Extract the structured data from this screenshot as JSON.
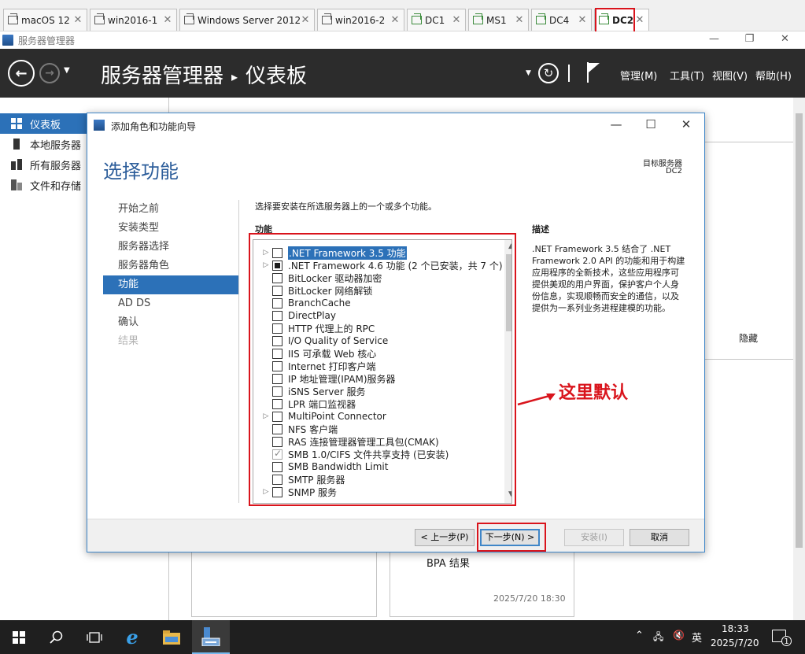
{
  "vm_tabs": [
    {
      "label": "macOS 12",
      "active": false
    },
    {
      "label": "win2016-1",
      "active": false
    },
    {
      "label": "Windows Server 2012",
      "active": false
    },
    {
      "label": "win2016-2",
      "active": false
    },
    {
      "label": "DC1",
      "active": false
    },
    {
      "label": "MS1",
      "active": false
    },
    {
      "label": "DC4",
      "active": false
    },
    {
      "label": "DC2",
      "active": true
    }
  ],
  "window": {
    "title": "服务器管理器",
    "minimize": "—",
    "restore": "❐",
    "close": "✕"
  },
  "header": {
    "breadcrumb_root": "服务器管理器",
    "breadcrumb_separator": "▸",
    "breadcrumb_current": "仪表板",
    "menus": [
      "管理(M)",
      "工具(T)",
      "视图(V)",
      "帮助(H)"
    ]
  },
  "sidebar": {
    "items": [
      {
        "label": "仪表板",
        "active": true
      },
      {
        "label": "本地服务器",
        "active": false
      },
      {
        "label": "所有服务器",
        "active": false
      },
      {
        "label": "文件和存储",
        "active": false
      }
    ]
  },
  "dashboard": {
    "hide_link": "隐藏",
    "tile_bpa_label": "BPA 结果",
    "tile_timestamp": "2025/7/20 18:30"
  },
  "wizard": {
    "title": "添加角色和功能向导",
    "heading": "选择功能",
    "target_label": "目标服务器",
    "target_value": "DC2",
    "steps": [
      {
        "label": "开始之前",
        "state": "normal"
      },
      {
        "label": "安装类型",
        "state": "normal"
      },
      {
        "label": "服务器选择",
        "state": "normal"
      },
      {
        "label": "服务器角色",
        "state": "normal"
      },
      {
        "label": "功能",
        "state": "current"
      },
      {
        "label": "AD DS",
        "state": "normal"
      },
      {
        "label": "确认",
        "state": "normal"
      },
      {
        "label": "结果",
        "state": "disabled"
      }
    ],
    "instruction": "选择要安装在所选服务器上的一个或多个功能。",
    "features_heading": "功能",
    "features": [
      {
        "label": ".NET Framework 3.5 功能",
        "expandable": true,
        "state": "unchecked",
        "selected": true
      },
      {
        "label": ".NET Framework 4.6 功能 (2 个已安装，共 7 个)",
        "expandable": true,
        "state": "partial",
        "selected": false
      },
      {
        "label": "BitLocker 驱动器加密",
        "expandable": false,
        "state": "unchecked",
        "selected": false
      },
      {
        "label": "BitLocker 网络解锁",
        "expandable": false,
        "state": "unchecked",
        "selected": false
      },
      {
        "label": "BranchCache",
        "expandable": false,
        "state": "unchecked",
        "selected": false
      },
      {
        "label": "DirectPlay",
        "expandable": false,
        "state": "unchecked",
        "selected": false
      },
      {
        "label": "HTTP 代理上的 RPC",
        "expandable": false,
        "state": "unchecked",
        "selected": false
      },
      {
        "label": "I/O Quality of Service",
        "expandable": false,
        "state": "unchecked",
        "selected": false
      },
      {
        "label": "IIS 可承载 Web 核心",
        "expandable": false,
        "state": "unchecked",
        "selected": false
      },
      {
        "label": "Internet 打印客户端",
        "expandable": false,
        "state": "unchecked",
        "selected": false
      },
      {
        "label": "IP 地址管理(IPAM)服务器",
        "expandable": false,
        "state": "unchecked",
        "selected": false
      },
      {
        "label": "iSNS Server 服务",
        "expandable": false,
        "state": "unchecked",
        "selected": false
      },
      {
        "label": "LPR 端口监视器",
        "expandable": false,
        "state": "unchecked",
        "selected": false
      },
      {
        "label": "MultiPoint Connector",
        "expandable": true,
        "state": "unchecked",
        "selected": false
      },
      {
        "label": "NFS 客户端",
        "expandable": false,
        "state": "unchecked",
        "selected": false
      },
      {
        "label": "RAS 连接管理器管理工具包(CMAK)",
        "expandable": false,
        "state": "unchecked",
        "selected": false
      },
      {
        "label": "SMB 1.0/CIFS 文件共享支持 (已安装)",
        "expandable": false,
        "state": "checked-disabled",
        "selected": false
      },
      {
        "label": "SMB Bandwidth Limit",
        "expandable": false,
        "state": "unchecked",
        "selected": false
      },
      {
        "label": "SMTP 服务器",
        "expandable": false,
        "state": "unchecked",
        "selected": false
      },
      {
        "label": "SNMP 服务",
        "expandable": true,
        "state": "unchecked",
        "selected": false
      }
    ],
    "description_heading": "描述",
    "description": ".NET Framework 3.5 结合了 .NET Framework 2.0 API 的功能和用于构建应用程序的全新技术，这些应用程序可提供美观的用户界面，保护客户个人身份信息，实现顺畅而安全的通信，以及提供为一系列业务进程建模的功能。",
    "buttons": {
      "previous": "< 上一步(P)",
      "next": "下一步(N) >",
      "install": "安装(I)",
      "cancel": "取消"
    }
  },
  "annotation": {
    "text": "这里默认",
    "color": "#d9141c"
  },
  "taskbar": {
    "time": "18:33",
    "date": "2025/7/20",
    "ime": "英",
    "notification_count": "1"
  }
}
